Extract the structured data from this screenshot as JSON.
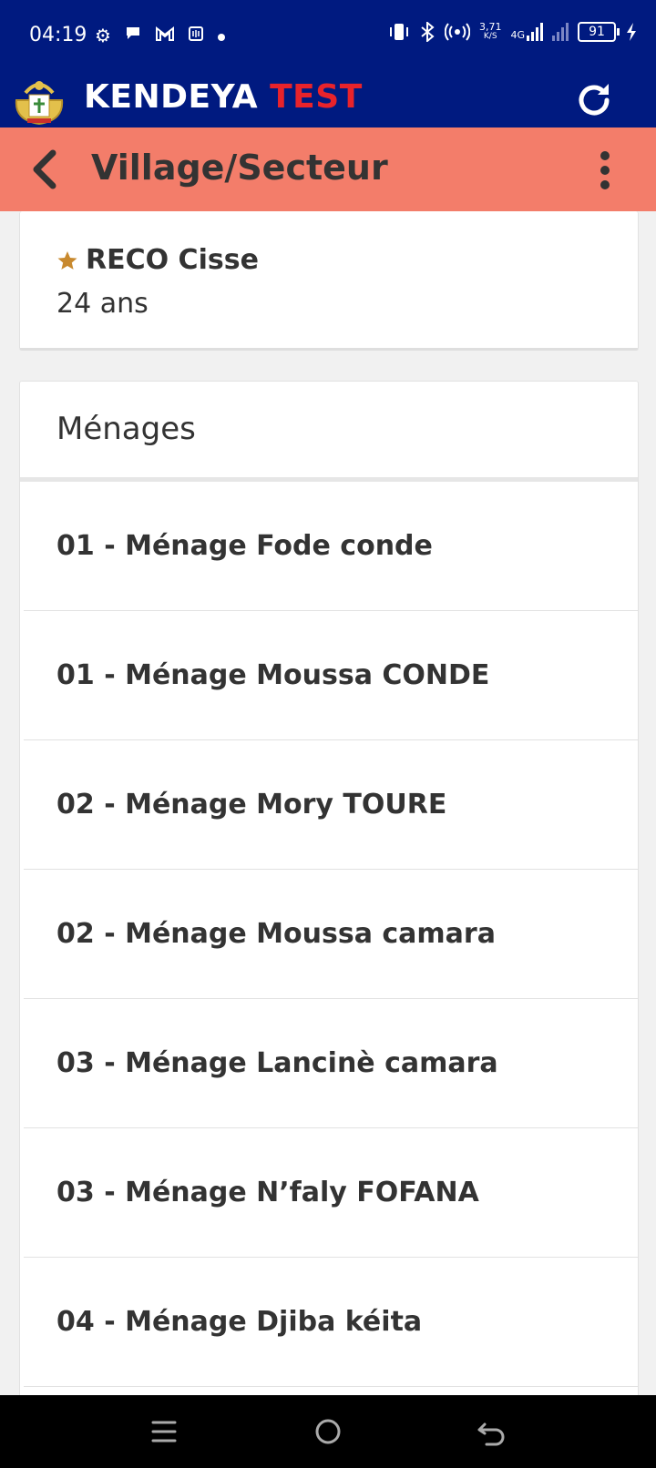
{
  "status_bar": {
    "time": "04:19",
    "net_speed_value": "3,71",
    "net_speed_unit": "K/S",
    "network_type": "4G",
    "battery": "91",
    "icons": [
      "settings-icon",
      "chat-icon",
      "gmail-icon",
      "nfc-icon",
      "notification-dot-icon",
      "vibrate-icon",
      "bluetooth-icon",
      "hotspot-icon",
      "signal-icon",
      "signal-icon",
      "battery-icon",
      "charging-icon"
    ]
  },
  "app_header": {
    "brand_part1": "KENDEYA",
    "brand_part2": "TEST",
    "logo": "coat-of-arms-logo",
    "refresh_icon": "refresh-icon"
  },
  "toolbar": {
    "title": "Village/Secteur",
    "back_icon": "chevron-left-icon",
    "menu_icon": "more-vertical-icon"
  },
  "reco": {
    "name": "RECO Cisse",
    "age": "24 ans",
    "icon": "star-icon"
  },
  "menages": {
    "header": "Ménages",
    "items": [
      "01 - Ménage Fode conde",
      "01 - Ménage Moussa CONDE",
      "02 - Ménage Mory TOURE",
      "02 - Ménage Moussa camara",
      "03 - Ménage Lancinè camara",
      "03 - Ménage N’faly FOFANA",
      "04 - Ménage Djiba kéita"
    ]
  },
  "colors": {
    "status_bar": "#001a80",
    "toolbar": "#f37d6a",
    "brand_accent": "#e8232b"
  }
}
